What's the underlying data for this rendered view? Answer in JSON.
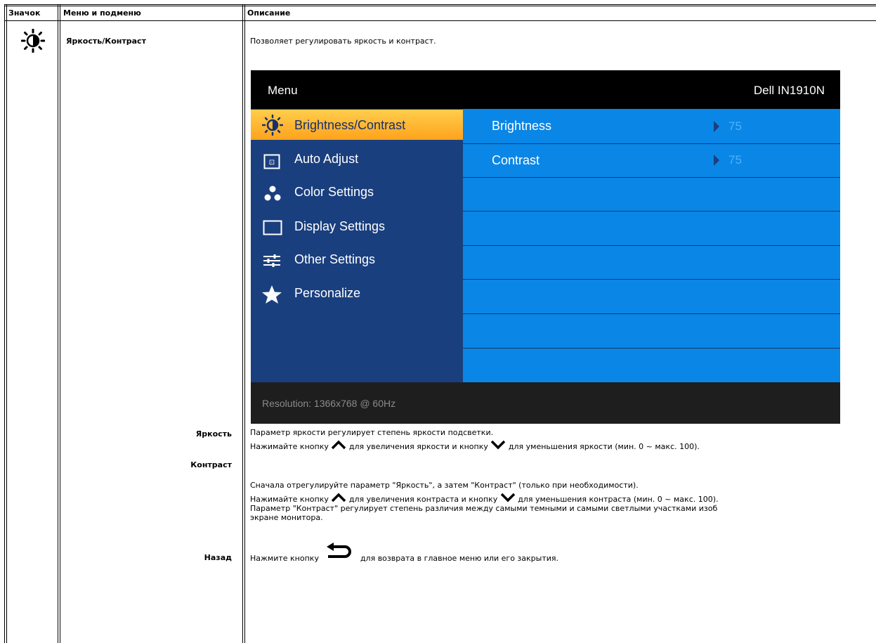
{
  "table": {
    "headers": [
      "Значок",
      "Меню и подменю",
      "Описание"
    ],
    "section_title": "Яркость/Контраст",
    "section_desc": "Позволяет регулировать яркость и контраст."
  },
  "osd": {
    "title": "Menu",
    "model": "Dell IN1910N",
    "menu_items": [
      {
        "label": "Brightness/Contrast",
        "icon": "sun-contrast-icon",
        "selected": true
      },
      {
        "label": "Auto Adjust",
        "icon": "auto-adjust-icon"
      },
      {
        "label": "Color Settings",
        "icon": "color-dots-icon"
      },
      {
        "label": "Display Settings",
        "icon": "display-rect-icon"
      },
      {
        "label": "Other Settings",
        "icon": "sliders-icon"
      },
      {
        "label": "Personalize",
        "icon": "star-icon"
      }
    ],
    "rows": [
      {
        "label": "Brightness",
        "value": "75"
      },
      {
        "label": "Contrast",
        "value": "75"
      }
    ],
    "footer": "Resolution: 1366x768 @ 60Hz"
  },
  "brightness": {
    "label": "Яркость",
    "line1": "Параметр яркости регулирует степень яркости подсветки.",
    "line2_a": "Нажимайте кнопку",
    "line2_b": "для увеличения яркости и кнопку",
    "line2_c": "для уменьшения яркости (мин. 0 ~ макс. 100)."
  },
  "contrast": {
    "label": "Контраст",
    "line1": "Сначала отрегулируйте параметр \"Яркость\", а затем \"Контраст\" (только при необходимости).",
    "line2_a": "Нажимайте кнопку",
    "line2_b": "для увеличения контраста и кнопку",
    "line2_c": "для уменьшения контраста (мин. 0 ~ макс. 100).",
    "line3": "Параметр \"Контраст\" регулирует степень различия между самыми темными и самыми светлыми участками изоб",
    "line4": "экране монитора."
  },
  "back": {
    "label": "Назад",
    "line_a": "Нажмите кнопку",
    "line_b": "для  возврата в главное меню или его закрытия."
  },
  "colors": {
    "osd_left": "#1a3f7e",
    "osd_right": "#0a86e6",
    "selected": "#ffa21c"
  }
}
